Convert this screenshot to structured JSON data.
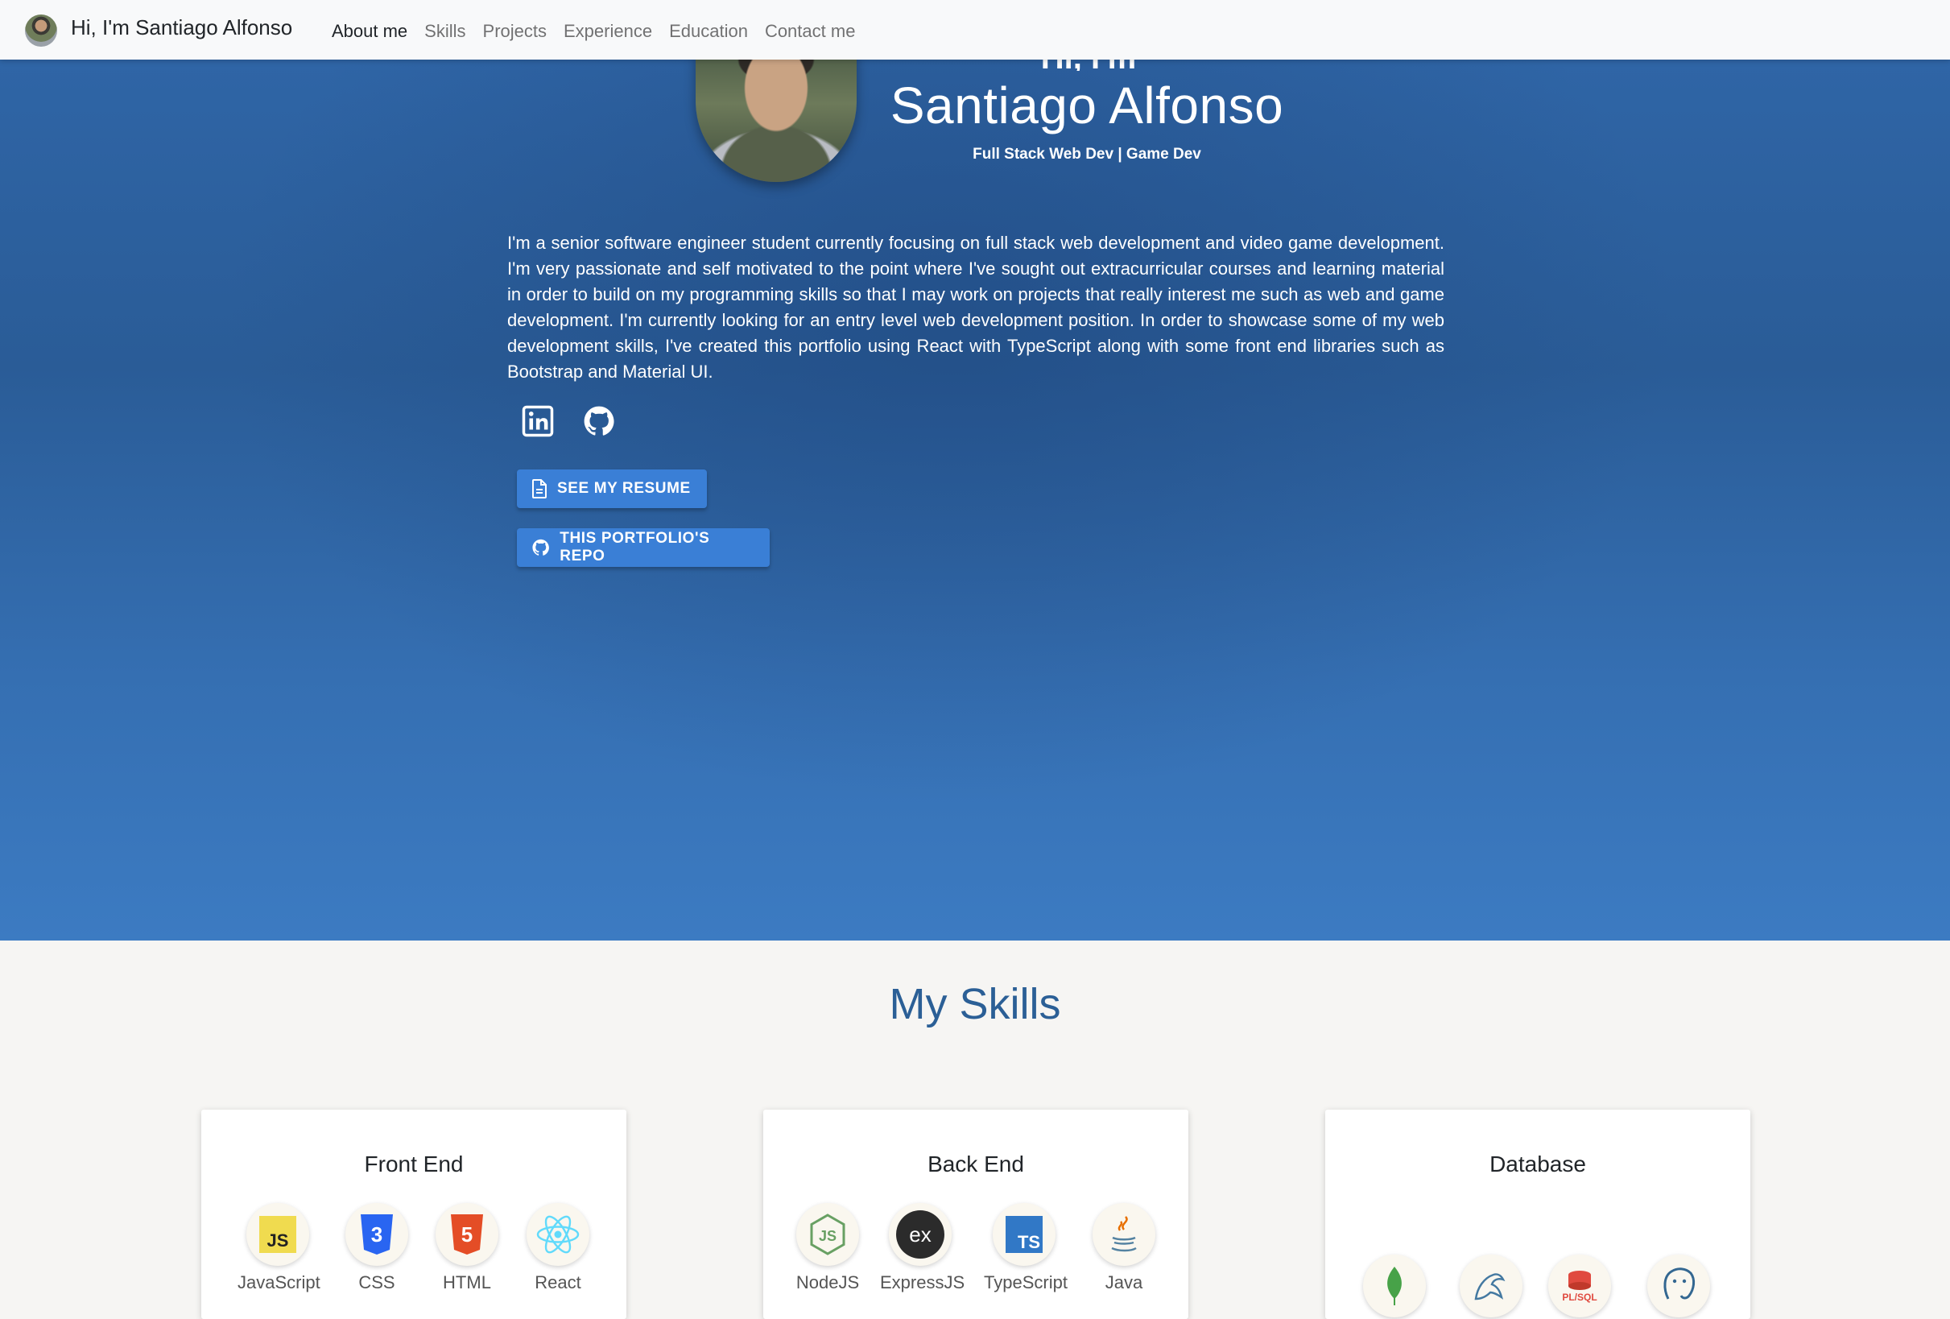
{
  "nav": {
    "brand": "Hi, I'm Santiago Alfonso",
    "links": [
      "About me",
      "Skills",
      "Projects",
      "Experience",
      "Education",
      "Contact me"
    ]
  },
  "hero": {
    "partial_greeting": "Hi, I'm",
    "name": "Santiago Alfonso",
    "subtitle": "Full Stack Web Dev | Game Dev",
    "bio": "I'm a senior software engineer student currently focusing on full stack web development and video game development. I'm very passionate and self motivated to the point where I've sought out extracurricular courses and learning material in order to build on my programming skills so that I may work on projects that really interest me such as web and game development. I'm currently looking for an entry level web development position. In order to showcase some of my web development skills, I've created this portfolio using React with TypeScript along with some front end libraries such as Bootstrap and Material UI.",
    "resume_button": "SEE MY RESUME",
    "repo_button": "THIS PORTFOLIO'S REPO"
  },
  "skills": {
    "title": "My Skills",
    "front_end": {
      "title": "Front End",
      "items": [
        "JavaScript",
        "CSS",
        "HTML",
        "React"
      ]
    },
    "back_end": {
      "title": "Back End",
      "items": [
        "NodeJS",
        "ExpressJS",
        "TypeScript",
        "Java"
      ]
    },
    "database": {
      "title": "Database"
    }
  },
  "colors": {
    "hero_blue": "#2f65a6",
    "button_blue": "#3a7fd6",
    "skills_title": "#2b5f96",
    "navbar_bg": "#f8f9fa"
  }
}
